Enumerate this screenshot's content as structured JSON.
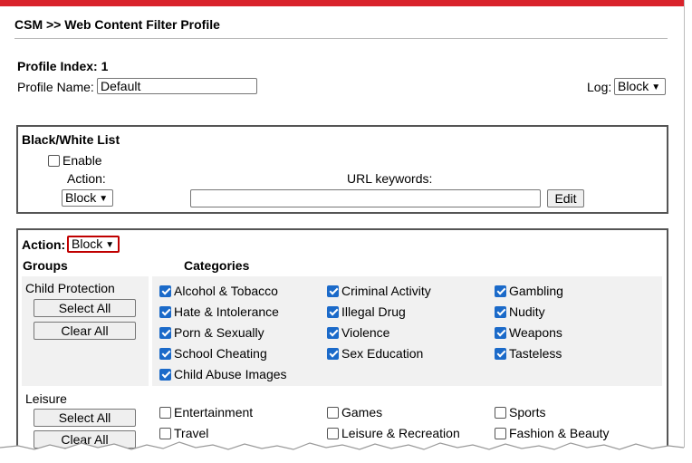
{
  "header": {
    "title": "CSM >> Web Content Filter Profile"
  },
  "profile": {
    "index_label": "Profile Index: 1",
    "name_label": "Profile Name:",
    "name_value": "Default",
    "log_label": "Log:",
    "log_value": "Block"
  },
  "bwlist": {
    "title": "Black/White List",
    "enable_label": "Enable",
    "enable_checked": false,
    "action_label": "Action:",
    "action_value": "Block",
    "url_keywords_label": "URL keywords:",
    "url_keywords_value": "",
    "edit_label": "Edit"
  },
  "categories_section": {
    "action_label": "Action:",
    "action_value": "Block",
    "groups_header": "Groups",
    "categories_header": "Categories",
    "select_all_label": "Select All",
    "clear_all_label": "Clear All",
    "groups": [
      {
        "name": "Child Protection",
        "items": [
          {
            "label": "Alcohol & Tobacco",
            "checked": true
          },
          {
            "label": "Criminal Activity",
            "checked": true
          },
          {
            "label": "Gambling",
            "checked": true
          },
          {
            "label": "Hate & Intolerance",
            "checked": true
          },
          {
            "label": "Illegal Drug",
            "checked": true
          },
          {
            "label": "Nudity",
            "checked": true
          },
          {
            "label": "Porn & Sexually",
            "checked": true
          },
          {
            "label": "Violence",
            "checked": true
          },
          {
            "label": "Weapons",
            "checked": true
          },
          {
            "label": "School Cheating",
            "checked": true
          },
          {
            "label": "Sex Education",
            "checked": true
          },
          {
            "label": "Tasteless",
            "checked": true
          },
          {
            "label": "Child Abuse Images",
            "checked": true
          }
        ]
      },
      {
        "name": "Leisure",
        "items": [
          {
            "label": "Entertainment",
            "checked": false
          },
          {
            "label": "Games",
            "checked": false
          },
          {
            "label": "Sports",
            "checked": false
          },
          {
            "label": "Travel",
            "checked": false
          },
          {
            "label": "Leisure & Recreation",
            "checked": false
          },
          {
            "label": "Fashion & Beauty",
            "checked": false
          }
        ]
      }
    ]
  },
  "colors": {
    "accent_bar": "#d9232b",
    "checkbox": "#1b6ac9",
    "highlight_border": "#c00000"
  }
}
